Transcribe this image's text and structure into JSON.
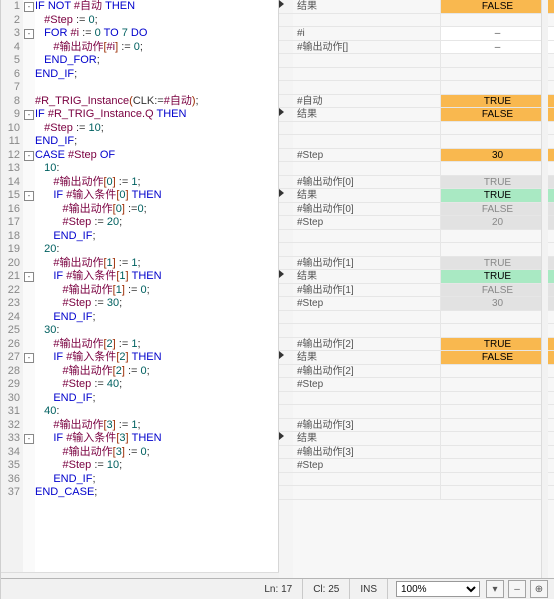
{
  "status": {
    "ln_label": "Ln:",
    "ln": "17",
    "cl_label": "Cl:",
    "cl": "25",
    "ins": "INS",
    "zoom": "100%"
  },
  "code": [
    {
      "n": "1",
      "fold": "-",
      "ind": 0,
      "t": [
        [
          "kw",
          "IF "
        ],
        [
          "kw",
          "NOT "
        ],
        [
          "id",
          "#自动"
        ],
        [
          "kw",
          " THEN"
        ]
      ]
    },
    {
      "n": "2",
      "fold": "",
      "ind": 1,
      "t": [
        [
          "id",
          "#Step"
        ],
        [
          "sym",
          " := "
        ],
        [
          "lit",
          "0"
        ],
        [
          "sym",
          ";"
        ]
      ]
    },
    {
      "n": "3",
      "fold": "-",
      "ind": 1,
      "t": [
        [
          "kw",
          "FOR "
        ],
        [
          "id",
          "#i"
        ],
        [
          "sym",
          " := "
        ],
        [
          "lit",
          "0"
        ],
        [
          "kw",
          " TO "
        ],
        [
          "lit",
          "7"
        ],
        [
          "kw",
          " DO"
        ]
      ]
    },
    {
      "n": "4",
      "fold": "",
      "ind": 2,
      "t": [
        [
          "id",
          "#输出动作"
        ],
        [
          "br",
          "["
        ],
        [
          "id",
          "#i"
        ],
        [
          "br",
          "]"
        ],
        [
          "sym",
          " := "
        ],
        [
          "lit",
          "0"
        ],
        [
          "sym",
          ";"
        ]
      ]
    },
    {
      "n": "5",
      "fold": "",
      "ind": 1,
      "t": [
        [
          "kw",
          "END_FOR"
        ],
        [
          "sym",
          ";"
        ]
      ]
    },
    {
      "n": "6",
      "fold": "",
      "ind": 0,
      "t": [
        [
          "kw",
          "END_IF"
        ],
        [
          "sym",
          ";"
        ]
      ]
    },
    {
      "n": "7",
      "fold": "",
      "ind": 0,
      "t": []
    },
    {
      "n": "8",
      "fold": "",
      "ind": 0,
      "t": [
        [
          "id",
          "#R_TRIG_Instance"
        ],
        [
          "br",
          "("
        ],
        [
          "sym",
          "CLK:="
        ],
        [
          "id",
          "#自动"
        ],
        [
          "br",
          ")"
        ],
        [
          "sym",
          ";"
        ]
      ]
    },
    {
      "n": "9",
      "fold": "-",
      "ind": 0,
      "t": [
        [
          "kw",
          "IF "
        ],
        [
          "id",
          "#R_TRIG_Instance.Q"
        ],
        [
          "kw",
          " THEN"
        ]
      ]
    },
    {
      "n": "10",
      "fold": "",
      "ind": 1,
      "t": [
        [
          "id",
          "#Step"
        ],
        [
          "sym",
          " := "
        ],
        [
          "lit",
          "10"
        ],
        [
          "sym",
          ";"
        ]
      ]
    },
    {
      "n": "11",
      "fold": "",
      "ind": 0,
      "t": [
        [
          "kw",
          "END_IF"
        ],
        [
          "sym",
          ";"
        ]
      ]
    },
    {
      "n": "12",
      "fold": "-",
      "ind": 0,
      "t": [
        [
          "kw",
          "CASE "
        ],
        [
          "id",
          "#Step"
        ],
        [
          "kw",
          " OF"
        ]
      ]
    },
    {
      "n": "13",
      "fold": "",
      "ind": 1,
      "t": [
        [
          "lit",
          "10"
        ],
        [
          "sym",
          ":"
        ]
      ]
    },
    {
      "n": "14",
      "fold": "",
      "ind": 2,
      "t": [
        [
          "id",
          "#输出动作"
        ],
        [
          "br",
          "["
        ],
        [
          "lit",
          "0"
        ],
        [
          "br",
          "]"
        ],
        [
          "sym",
          " := "
        ],
        [
          "lit",
          "1"
        ],
        [
          "sym",
          ";"
        ]
      ]
    },
    {
      "n": "15",
      "fold": "-",
      "ind": 2,
      "t": [
        [
          "kw",
          "IF "
        ],
        [
          "id",
          "#输入条件"
        ],
        [
          "br",
          "["
        ],
        [
          "lit",
          "0"
        ],
        [
          "br",
          "]"
        ],
        [
          "kw",
          " THEN"
        ]
      ]
    },
    {
      "n": "16",
      "fold": "",
      "ind": 3,
      "t": [
        [
          "id",
          "#输出动作"
        ],
        [
          "br",
          "["
        ],
        [
          "lit",
          "0"
        ],
        [
          "br",
          "]"
        ],
        [
          "sym",
          " :="
        ],
        [
          "lit",
          "0"
        ],
        [
          "sym",
          ";"
        ]
      ]
    },
    {
      "n": "17",
      "fold": "",
      "ind": 3,
      "t": [
        [
          "id",
          "#Step"
        ],
        [
          "sym",
          " := "
        ],
        [
          "lit",
          "20"
        ],
        [
          "sym",
          ";"
        ]
      ]
    },
    {
      "n": "18",
      "fold": "",
      "ind": 2,
      "t": [
        [
          "kw",
          "END_IF"
        ],
        [
          "sym",
          ";"
        ]
      ]
    },
    {
      "n": "19",
      "fold": "",
      "ind": 1,
      "t": [
        [
          "lit",
          "20"
        ],
        [
          "sym",
          ":"
        ]
      ]
    },
    {
      "n": "20",
      "fold": "",
      "ind": 2,
      "t": [
        [
          "id",
          "#输出动作"
        ],
        [
          "br",
          "["
        ],
        [
          "lit",
          "1"
        ],
        [
          "br",
          "]"
        ],
        [
          "sym",
          " := "
        ],
        [
          "lit",
          "1"
        ],
        [
          "sym",
          ";"
        ]
      ]
    },
    {
      "n": "21",
      "fold": "-",
      "ind": 2,
      "t": [
        [
          "kw",
          "IF "
        ],
        [
          "id",
          "#输入条件"
        ],
        [
          "br",
          "["
        ],
        [
          "lit",
          "1"
        ],
        [
          "br",
          "]"
        ],
        [
          "kw",
          " THEN"
        ]
      ]
    },
    {
      "n": "22",
      "fold": "",
      "ind": 3,
      "t": [
        [
          "id",
          "#输出动作"
        ],
        [
          "br",
          "["
        ],
        [
          "lit",
          "1"
        ],
        [
          "br",
          "]"
        ],
        [
          "sym",
          " := "
        ],
        [
          "lit",
          "0"
        ],
        [
          "sym",
          ";"
        ]
      ]
    },
    {
      "n": "23",
      "fold": "",
      "ind": 3,
      "t": [
        [
          "id",
          "#Step"
        ],
        [
          "sym",
          " := "
        ],
        [
          "lit",
          "30"
        ],
        [
          "sym",
          ";"
        ]
      ]
    },
    {
      "n": "24",
      "fold": "",
      "ind": 2,
      "t": [
        [
          "kw",
          "END_IF"
        ],
        [
          "sym",
          ";"
        ]
      ]
    },
    {
      "n": "25",
      "fold": "",
      "ind": 1,
      "t": [
        [
          "lit",
          "30"
        ],
        [
          "sym",
          ":"
        ]
      ]
    },
    {
      "n": "26",
      "fold": "",
      "ind": 2,
      "t": [
        [
          "id",
          "#输出动作"
        ],
        [
          "br",
          "["
        ],
        [
          "lit",
          "2"
        ],
        [
          "br",
          "]"
        ],
        [
          "sym",
          " := "
        ],
        [
          "lit",
          "1"
        ],
        [
          "sym",
          ";"
        ]
      ]
    },
    {
      "n": "27",
      "fold": "-",
      "ind": 2,
      "t": [
        [
          "kw",
          "IF "
        ],
        [
          "id",
          "#输入条件"
        ],
        [
          "br",
          "["
        ],
        [
          "lit",
          "2"
        ],
        [
          "br",
          "]"
        ],
        [
          "kw",
          " THEN"
        ]
      ]
    },
    {
      "n": "28",
      "fold": "",
      "ind": 3,
      "t": [
        [
          "id",
          "#输出动作"
        ],
        [
          "br",
          "["
        ],
        [
          "lit",
          "2"
        ],
        [
          "br",
          "]"
        ],
        [
          "sym",
          " := "
        ],
        [
          "lit",
          "0"
        ],
        [
          "sym",
          ";"
        ]
      ]
    },
    {
      "n": "29",
      "fold": "",
      "ind": 3,
      "t": [
        [
          "id",
          "#Step"
        ],
        [
          "sym",
          " := "
        ],
        [
          "lit",
          "40"
        ],
        [
          "sym",
          ";"
        ]
      ]
    },
    {
      "n": "30",
      "fold": "",
      "ind": 2,
      "t": [
        [
          "kw",
          "END_IF"
        ],
        [
          "sym",
          ";"
        ]
      ]
    },
    {
      "n": "31",
      "fold": "",
      "ind": 1,
      "t": [
        [
          "lit",
          "40"
        ],
        [
          "sym",
          ":"
        ]
      ]
    },
    {
      "n": "32",
      "fold": "",
      "ind": 2,
      "t": [
        [
          "id",
          "#输出动作"
        ],
        [
          "br",
          "["
        ],
        [
          "lit",
          "3"
        ],
        [
          "br",
          "]"
        ],
        [
          "sym",
          " := "
        ],
        [
          "lit",
          "1"
        ],
        [
          "sym",
          ";"
        ]
      ]
    },
    {
      "n": "33",
      "fold": "-",
      "ind": 2,
      "t": [
        [
          "kw",
          "IF "
        ],
        [
          "id",
          "#输入条件"
        ],
        [
          "br",
          "["
        ],
        [
          "lit",
          "3"
        ],
        [
          "br",
          "]"
        ],
        [
          "kw",
          " THEN"
        ]
      ]
    },
    {
      "n": "34",
      "fold": "",
      "ind": 3,
      "t": [
        [
          "id",
          "#输出动作"
        ],
        [
          "br",
          "["
        ],
        [
          "lit",
          "3"
        ],
        [
          "br",
          "]"
        ],
        [
          "sym",
          " := "
        ],
        [
          "lit",
          "0"
        ],
        [
          "sym",
          ";"
        ]
      ]
    },
    {
      "n": "35",
      "fold": "",
      "ind": 3,
      "t": [
        [
          "id",
          "#Step"
        ],
        [
          "sym",
          " := "
        ],
        [
          "lit",
          "10"
        ],
        [
          "sym",
          ";"
        ]
      ]
    },
    {
      "n": "36",
      "fold": "",
      "ind": 2,
      "t": [
        [
          "kw",
          "END_IF"
        ],
        [
          "sym",
          ";"
        ]
      ]
    },
    {
      "n": "37",
      "fold": "",
      "ind": 0,
      "t": [
        [
          "kw",
          "END_CASE"
        ],
        [
          "sym",
          ";"
        ]
      ]
    }
  ],
  "monitor": [
    {
      "mark": "▶",
      "name": "结果",
      "val": "FALSE",
      "cls": "v-false"
    },
    {
      "mark": "",
      "name": "",
      "val": "",
      "cls": ""
    },
    {
      "mark": "",
      "name": "#i",
      "val": "–",
      "cls": "v-dash"
    },
    {
      "mark": "",
      "name": "#输出动作[]",
      "val": "–",
      "cls": "v-dash"
    },
    {
      "mark": "",
      "name": "",
      "val": "",
      "cls": ""
    },
    {
      "mark": "",
      "name": "",
      "val": "",
      "cls": ""
    },
    {
      "mark": "",
      "name": "",
      "val": "",
      "cls": ""
    },
    {
      "mark": "",
      "name": "#自动",
      "val": "TRUE",
      "cls": "v-true"
    },
    {
      "mark": "▶",
      "name": "结果",
      "val": "FALSE",
      "cls": "v-false"
    },
    {
      "mark": "",
      "name": "",
      "val": "",
      "cls": ""
    },
    {
      "mark": "",
      "name": "",
      "val": "",
      "cls": ""
    },
    {
      "mark": "",
      "name": "#Step",
      "val": "30",
      "cls": "v-num"
    },
    {
      "mark": "",
      "name": "",
      "val": "",
      "cls": ""
    },
    {
      "mark": "",
      "name": "#输出动作[0]",
      "val": "TRUE",
      "cls": "v-gray"
    },
    {
      "mark": "▶",
      "name": "结果",
      "val": "TRUE",
      "cls": "v-truegn"
    },
    {
      "mark": "",
      "name": "#输出动作[0]",
      "val": "FALSE",
      "cls": "v-gray"
    },
    {
      "mark": "",
      "name": "#Step",
      "val": "20",
      "cls": "v-gray"
    },
    {
      "mark": "",
      "name": "",
      "val": "",
      "cls": ""
    },
    {
      "mark": "",
      "name": "",
      "val": "",
      "cls": ""
    },
    {
      "mark": "",
      "name": "#输出动作[1]",
      "val": "TRUE",
      "cls": "v-gray"
    },
    {
      "mark": "▶",
      "name": "结果",
      "val": "TRUE",
      "cls": "v-truegn"
    },
    {
      "mark": "",
      "name": "#输出动作[1]",
      "val": "FALSE",
      "cls": "v-gray"
    },
    {
      "mark": "",
      "name": "#Step",
      "val": "30",
      "cls": "v-gray"
    },
    {
      "mark": "",
      "name": "",
      "val": "",
      "cls": ""
    },
    {
      "mark": "",
      "name": "",
      "val": "",
      "cls": ""
    },
    {
      "mark": "",
      "name": "#输出动作[2]",
      "val": "TRUE",
      "cls": "v-true"
    },
    {
      "mark": "▶",
      "name": "结果",
      "val": "FALSE",
      "cls": "v-false"
    },
    {
      "mark": "",
      "name": "#输出动作[2]",
      "val": "",
      "cls": ""
    },
    {
      "mark": "",
      "name": "#Step",
      "val": "",
      "cls": ""
    },
    {
      "mark": "",
      "name": "",
      "val": "",
      "cls": ""
    },
    {
      "mark": "",
      "name": "",
      "val": "",
      "cls": ""
    },
    {
      "mark": "",
      "name": "#输出动作[3]",
      "val": "",
      "cls": ""
    },
    {
      "mark": "▶",
      "name": "结果",
      "val": "",
      "cls": ""
    },
    {
      "mark": "",
      "name": "#输出动作[3]",
      "val": "",
      "cls": ""
    },
    {
      "mark": "",
      "name": "#Step",
      "val": "",
      "cls": ""
    },
    {
      "mark": "",
      "name": "",
      "val": "",
      "cls": ""
    },
    {
      "mark": "",
      "name": "",
      "val": "",
      "cls": ""
    }
  ]
}
